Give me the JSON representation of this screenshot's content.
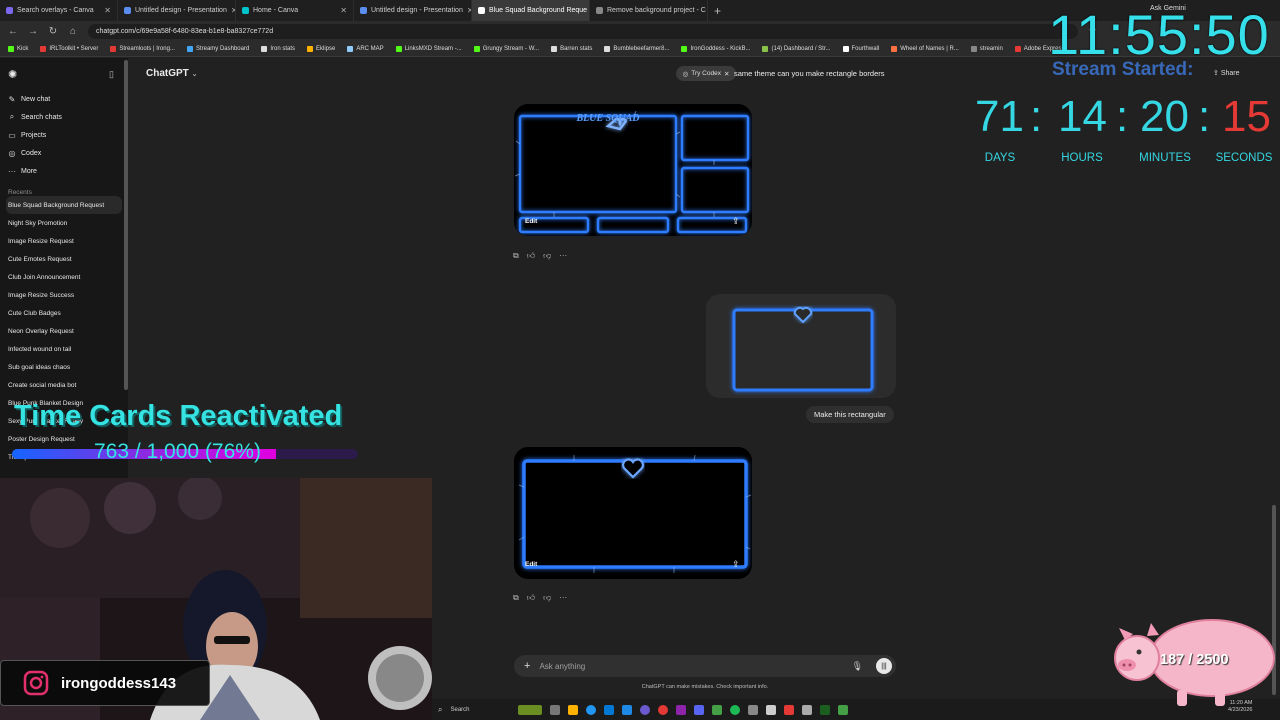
{
  "browser": {
    "tabs": [
      {
        "title": "Search overlays - Canva"
      },
      {
        "title": "Untitled design - Presentation"
      },
      {
        "title": "Home - Canva"
      },
      {
        "title": "Untitled design - Presentation"
      },
      {
        "title": "Blue Squad Background Reque"
      },
      {
        "title": "Remove background project - C"
      }
    ],
    "url": "chatgpt.com/c/69e9a58f-6480-83ea-b1e8-ba8327ce772d",
    "ask_gemini": "Ask Gemini",
    "bookmarks": [
      "Kick",
      "IRLToolkit • Server",
      "Streamloots | Irong...",
      "Streamy Dashboard",
      "Iron stats",
      "Eklipse",
      "ARC MAP",
      "LinksMXD Stream -...",
      "Grungy Stream - W...",
      "Barren stats",
      "Bumblebeefarmer8...",
      "IronGoddess - KickB...",
      "(14) Dashboard / Str...",
      "Fourthwall",
      "Wheel of Names | R...",
      "streamin",
      "Adobe Express"
    ]
  },
  "sidebar": {
    "items": [
      {
        "label": "New chat",
        "icon": "new-chat-icon"
      },
      {
        "label": "Search chats",
        "icon": "search-icon"
      },
      {
        "label": "Projects",
        "icon": "folder-icon"
      },
      {
        "label": "Codex",
        "icon": "codex-icon"
      },
      {
        "label": "More",
        "icon": "more-icon"
      }
    ],
    "recents_label": "Recents",
    "recents": [
      "Blue Squad Background Request",
      "Night Sky Promotion",
      "Image Resize Request",
      "Cute Emotes Request",
      "Club Join Announcement",
      "Image Resize Success",
      "Cute Club Badges",
      "Neon Overlay Request",
      "Infected wound on tail",
      "Sub goal ideas chaos",
      "Create social media bot",
      "Blue Punk Blanket Design",
      "Sexy Punk Blanket Ready",
      "Poster Design Request",
      "Transparent Outside Circle"
    ]
  },
  "chat": {
    "model": "ChatGPT",
    "try_codex": "Try Codex",
    "user_message_1": "same theme can you make rectangle borders",
    "share": "Share",
    "image1_title": "BLUE SQUAD",
    "edit_label": "Edit",
    "user_message_2": "Make this rectangular",
    "input_placeholder": "Ask anything",
    "disclaimer": "ChatGPT can make mistakes. Check important info."
  },
  "overlay": {
    "clock": "11:55:50",
    "stream_started": "Stream Started:",
    "countdown": {
      "days": "71",
      "hours": "14",
      "minutes": "20",
      "seconds": "15"
    },
    "countdown_labels": {
      "days": "DAYS",
      "hours": "HOURS",
      "minutes": "MINUTES",
      "seconds": "SECONDS"
    },
    "sub_goal_title": "Time Cards Reactivated",
    "sub_goal_progress": "763 / 1,000 (76%)",
    "sub_goal_fraction": 0.763,
    "instagram_handle": "irongoddess143",
    "pig_goal": "187 / 2500"
  },
  "taskbar": {
    "search": "Search",
    "time": "11:20 AM",
    "date": "4/23/2026"
  },
  "colors": {
    "cyan": "#35e0ea",
    "seconds_red": "#e53935",
    "accent_blue": "#1e6bff",
    "pig_pink": "#f4b6c8"
  }
}
